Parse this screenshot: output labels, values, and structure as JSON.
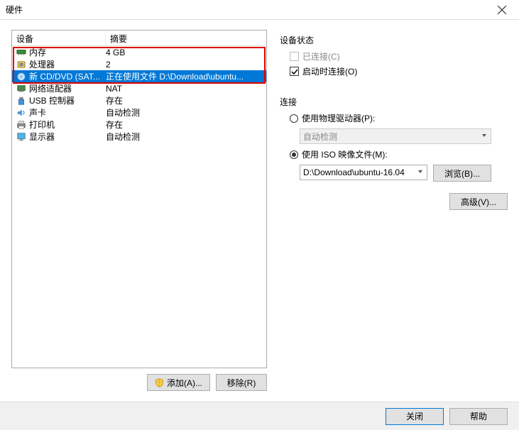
{
  "window": {
    "title": "硬件"
  },
  "table": {
    "headers": {
      "device": "设备",
      "summary": "摘要"
    },
    "rows": [
      {
        "name": "内存",
        "summary": "4 GB",
        "icon": "memory",
        "selected": false
      },
      {
        "name": "处理器",
        "summary": "2",
        "icon": "cpu",
        "selected": false
      },
      {
        "name": "新 CD/DVD (SAT...",
        "summary": "正在使用文件 D:\\Download\\ubuntu...",
        "icon": "cd",
        "selected": true
      },
      {
        "name": "网络适配器",
        "summary": "NAT",
        "icon": "net",
        "selected": false
      },
      {
        "name": "USB 控制器",
        "summary": "存在",
        "icon": "usb",
        "selected": false
      },
      {
        "name": "声卡",
        "summary": "自动检测",
        "icon": "sound",
        "selected": false
      },
      {
        "name": "打印机",
        "summary": "存在",
        "icon": "printer",
        "selected": false
      },
      {
        "name": "显示器",
        "summary": "自动检测",
        "icon": "display",
        "selected": false
      }
    ]
  },
  "left_buttons": {
    "add": "添加(A)...",
    "remove": "移除(R)"
  },
  "right_panel": {
    "device_status": {
      "label": "设备状态",
      "connected": {
        "label": "已连接(C)",
        "checked": false,
        "disabled": true
      },
      "connect_at_power": {
        "label": "启动时连接(O)",
        "checked": true,
        "disabled": false
      }
    },
    "connection": {
      "label": "连接",
      "physical": {
        "label": "使用物理驱动器(P):",
        "selected": false
      },
      "auto_detect": "自动检测",
      "iso": {
        "label": "使用 ISO 映像文件(M):",
        "selected": true
      },
      "iso_path": "D:\\Download\\ubuntu-16.04",
      "browse": "浏览(B)..."
    },
    "advanced": "高级(V)..."
  },
  "footer": {
    "close": "关闭",
    "help": "帮助"
  }
}
